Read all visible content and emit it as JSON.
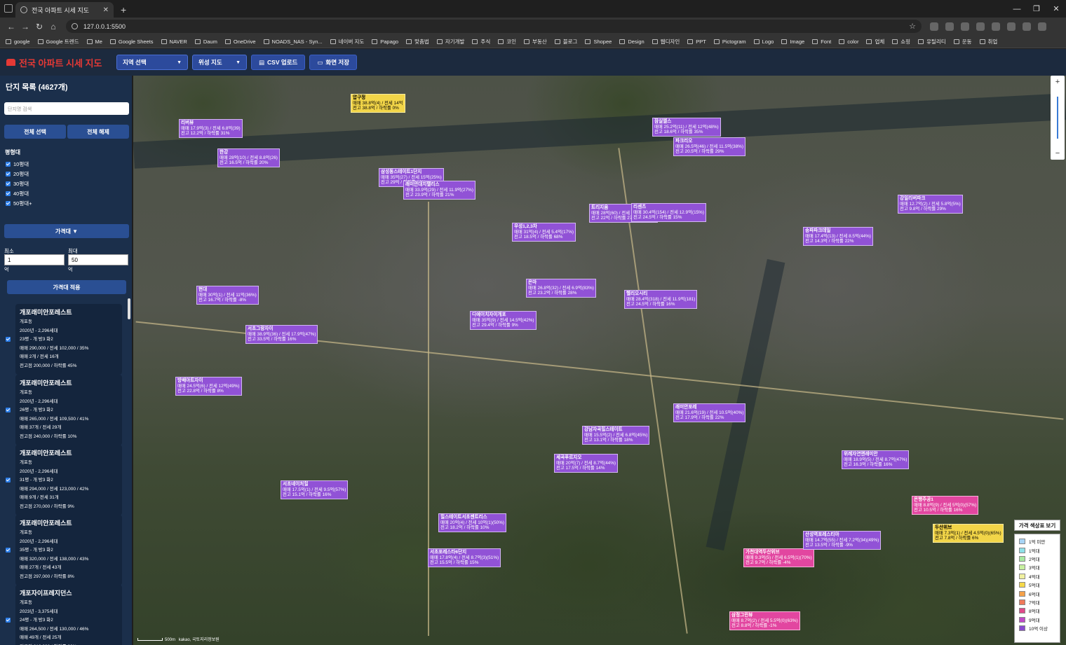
{
  "browser": {
    "tab_title": "전국 아파트 시세 지도",
    "new_tab": "+",
    "url": "127.0.0.1:5500",
    "bookmarks": [
      "google",
      "Google 트렌드",
      "Me",
      "Google Sheets",
      "NAVER",
      "Daum",
      "OneDrive",
      "NOADS_NAS - Syn...",
      "네이버 지도",
      "Papago",
      "맞춤법",
      "자기개발",
      "주식",
      "코인",
      "부동산",
      "블로그",
      "Shopee",
      "Design",
      "웹디자인",
      "PPT",
      "Pictogram",
      "Logo",
      "Image",
      "Font",
      "color",
      "업체",
      "쇼핑",
      "유틸리티",
      "운동",
      "취업"
    ]
  },
  "header": {
    "title": "전국 아파트 시세 지도",
    "region_select": "지역 선택",
    "map_type_select": "위성 지도",
    "csv_button": "CSV 업로드",
    "save_button": "화면 저장"
  },
  "sidebar": {
    "title": "단지 목록 (4627개)",
    "search_placeholder": "단지명 검색",
    "select_all": "전체 선택",
    "deselect_all": "전체 해제",
    "size_label": "평형대",
    "sizes": [
      "10평대",
      "20평대",
      "30평대",
      "40평대",
      "50평대+"
    ],
    "price_toggle": "가격대 ▼",
    "min_label": "최소",
    "max_label": "최대",
    "min_value": "1",
    "max_value": "50",
    "unit": "억",
    "apply": "가격대 적용",
    "properties": [
      {
        "name": "개포래미안포레스트",
        "lines": [
          "개포동",
          "2020년 - 2,296세대",
          "23평 - 개 방3 화2",
          "매매 290,000 / 전세 102,000 / 35%",
          "매매 2개 / 전세 16개",
          "전고점 200,000 / 하락률 45%"
        ]
      },
      {
        "name": "개포래미안포레스트",
        "lines": [
          "개포동",
          "2020년 - 2,296세대",
          "26평 - 개 방3 화2",
          "매매 265,000 / 전세 109,500 / 41%",
          "매매 37개 / 전세 29개",
          "전고점 240,000 / 하락률 10%"
        ]
      },
      {
        "name": "개포래미안포레스트",
        "lines": [
          "개포동",
          "2020년 - 2,296세대",
          "31평 - 개 방3 화2",
          "매매 294,000 / 전세 123,000 / 42%",
          "매매 9개 / 전세 31개",
          "전고점 270,000 / 하락률 9%"
        ]
      },
      {
        "name": "개포래미안포레스트",
        "lines": [
          "개포동",
          "2020년 - 2,296세대",
          "35평 - 개 방3 화2",
          "매매 320,000 / 전세 138,000 / 43%",
          "매매 27개 / 전세 43개",
          "전고점 297,000 / 하락률 8%"
        ]
      },
      {
        "name": "개포자이프레지던스",
        "lines": [
          "개포동",
          "2023년 - 3,375세대",
          "24평 - 개 방3 화2",
          "매매 264,500 / 전세 130,000 / 46%",
          "매매 49개 / 전세 25개",
          "전고점 219,300 / 하락률 30%"
        ]
      }
    ]
  },
  "map": {
    "labels": [
      {
        "name": "현대",
        "l1": "매매 30억(1) / 전세 11억(36%)",
        "l2": "전고 16.7억 / 하락률 -8%",
        "style": "purple"
      },
      {
        "name": "압구정",
        "l1": "매매 38.8억(4) / 전세 14억",
        "l2": "전고 38.8억 / 하락률 0%",
        "style": "yellow"
      },
      {
        "name": "잠실엘스",
        "l1": "매매 25.2억(11) / 전세 12억(48%)",
        "l2": "전고 18.6억 / 하락률 35%",
        "style": "purple"
      },
      {
        "name": "리버뷰",
        "l1": "매매 17.9억(3) / 전세 6.8억(39)",
        "l2": "전고 12.2억 / 하락률 31%",
        "style": "purple"
      },
      {
        "name": "한강",
        "l1": "매매 28억(10) / 전세 8.8억(26)",
        "l2": "전고 16.5억 / 하락률 20%",
        "style": "purple"
      },
      {
        "name": "삼성동스테이트1단지",
        "l1": "매매 35억(27) / 전세 15억(25%)",
        "l2": "전고 29억 / 하락률 13%",
        "style": "purple"
      },
      {
        "name": "우성1,2,3차",
        "l1": "매매 31억(4) / 전세 5.4억(17%)",
        "l2": "전고 18.5억 / 하락률 68%",
        "style": "purple"
      },
      {
        "name": "트리지움",
        "l1": "매매 28억(60) / 전세 12.1억(42%)",
        "l2": "전고 22억 / 하락률 27%",
        "style": "purple"
      },
      {
        "name": "파크리오",
        "l1": "매매 26.5억(46) / 전세 11.5억(38%)",
        "l2": "전고 20.5억 / 하락률 29%",
        "style": "purple"
      },
      {
        "name": "리센츠",
        "l1": "매매 30.4억(154) / 전세 12.9억(15%)",
        "l2": "전고 24.5억 / 하락률 15%",
        "style": "purple"
      },
      {
        "name": "래미안대치팰리스",
        "l1": "매매 33.9억(29) / 전세 11.9억(27%)",
        "l2": "전고 23.9억 / 하락률 21%",
        "style": "purple"
      },
      {
        "name": "은마",
        "l1": "매매 26.8억(32) / 전세 6.9억(83%)",
        "l2": "전고 23.2억 / 하락률 28%",
        "style": "purple"
      },
      {
        "name": "헬리오시티",
        "l1": "매매 28.4억(318) / 전세 11.9억(181)",
        "l2": "전고 24.5억 / 하락률 16%",
        "style": "purple"
      },
      {
        "name": "송파파크데일",
        "l1": "매매 17.4억(13) / 전세 8.5억(44%)",
        "l2": "전고 14.3억 / 하락률 22%",
        "style": "purple"
      },
      {
        "name": "강일리버파크",
        "l1": "매매 12.7억(2) / 전세 5.8억(5%)",
        "l2": "전고 9.8억 / 하락률 29%",
        "style": "purple"
      },
      {
        "name": "디에이치자이개포",
        "l1": "매매 35억(9) / 전세 14.5억(42%)",
        "l2": "전고 29.4억 / 하락률 9%",
        "style": "purple"
      },
      {
        "name": "서초그랑자이",
        "l1": "매매 38.9억(36) / 전세 17.9억(47%)",
        "l2": "전고 33.5억 / 하락률 16%",
        "style": "purple"
      },
      {
        "name": "방배아트자이",
        "l1": "매매 24.5억(6) / 전세 12억(49%)",
        "l2": "전고 22.8억 / 하락률 8%",
        "style": "purple"
      },
      {
        "name": "래미안포레",
        "l1": "매매 21.6억(19) / 전세 10.5억(40%)",
        "l2": "전고 17.9억 / 하락률 22%",
        "style": "purple"
      },
      {
        "name": "강남자곡힐스테이트",
        "l1": "매매 15.5억(2) / 전세 6.8억(45%)",
        "l2": "전고 13.1억 / 하락률 18%",
        "style": "purple"
      },
      {
        "name": "세곡푸르지오",
        "l1": "매매 20억(7) / 전세 8.7억(44%)",
        "l2": "전고 17.5억 / 하락률 14%",
        "style": "purple"
      },
      {
        "name": "위례자연앤래미안",
        "l1": "매매 18.9억(5) / 전세 8.7억(47%)",
        "l2": "전고 16.3억 / 하락률 16%",
        "style": "purple"
      },
      {
        "name": "서초네이처힐",
        "l1": "매매 17.5억(1) / 전세 9.5억(57%)",
        "l2": "전고 15.1억 / 하락률 16%",
        "style": "purple"
      },
      {
        "name": "힐스테이트서초젠트리스",
        "l1": "매매 20억(4) / 전세 10억(1)(50%)",
        "l2": "전고 18.2억 / 하락률 10%",
        "style": "purple"
      },
      {
        "name": "서초포레스타6단지",
        "l1": "매매 17.8억(4) / 전세 8.7억(3)(51%)",
        "l2": "전고 15.5억 / 하락률 15%",
        "style": "purple"
      },
      {
        "name": "가천대역두산위브",
        "l1": "매매 9.3억(5) / 전세 6.5억(1)(70%)",
        "l2": "전고 9.7억 / 하락률 -4%",
        "style": "pink"
      },
      {
        "name": "은행주공1",
        "l1": "매매 8.8억(9) / 전세 5억(0)(57%)",
        "l2": "전고 10.5억 / 하락률 16%",
        "style": "pink"
      },
      {
        "name": "두산위브",
        "l1": "매매 7.3억(1) / 전세 4.5억(0)(65%)",
        "l2": "전고 7.8억 / 하락률 6%",
        "style": "yellow"
      },
      {
        "name": "삼정그린뷰",
        "l1": "매매 8.7억(2) / 전세 5.5억(0)(63%)",
        "l2": "전고 8.8억 / 하락률 -1%",
        "style": "pink"
      },
      {
        "name": "산성역포레스티아",
        "l1": "매매 14.7억(55) / 전세 7.2억(34)(49%)",
        "l2": "전고 13.5억 / 하락률 -9%",
        "style": "purple"
      }
    ],
    "scale": "500m",
    "attribution": "kakao, 국토지리정보원",
    "legend_button": "가격 색상표 보기",
    "legend": [
      {
        "label": "1억 미만",
        "color": "#a8d4f5"
      },
      {
        "label": "1억대",
        "color": "#8fe0e8"
      },
      {
        "label": "2억대",
        "color": "#a8e8a0"
      },
      {
        "label": "3억대",
        "color": "#c8f0a0"
      },
      {
        "label": "4억대",
        "color": "#f0f0a0"
      },
      {
        "label": "5억대",
        "color": "#f5d84a"
      },
      {
        "label": "6억대",
        "color": "#f5a24a"
      },
      {
        "label": "7억대",
        "color": "#f07a5a"
      },
      {
        "label": "8억대",
        "color": "#e04a8a"
      },
      {
        "label": "9억대",
        "color": "#c04ac8"
      },
      {
        "label": "10억 이상",
        "color": "#8a4ad0"
      }
    ]
  }
}
